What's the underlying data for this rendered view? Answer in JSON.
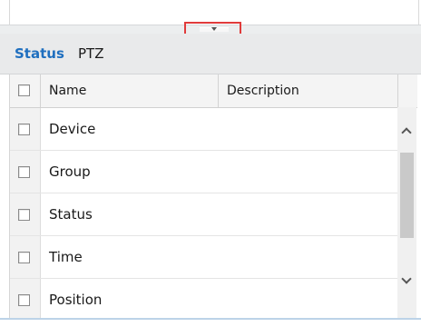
{
  "tabs": [
    {
      "label": "Status",
      "active": true
    },
    {
      "label": "PTZ",
      "active": false
    }
  ],
  "table": {
    "columns": [
      "Name",
      "Description"
    ],
    "rows": [
      {
        "name": "Device",
        "description": ""
      },
      {
        "name": "Group",
        "description": ""
      },
      {
        "name": "Status",
        "description": ""
      },
      {
        "name": "Time",
        "description": ""
      },
      {
        "name": "Position",
        "description": ""
      }
    ]
  },
  "colors": {
    "active_tab": "#1f6fbf",
    "highlight": "#e03b3b",
    "tab_bar": "#e9eaeb"
  },
  "icons": {
    "splitter": "chevron-down-icon",
    "scroll_up": "chevron-up-icon",
    "scroll_down": "chevron-down-icon"
  }
}
